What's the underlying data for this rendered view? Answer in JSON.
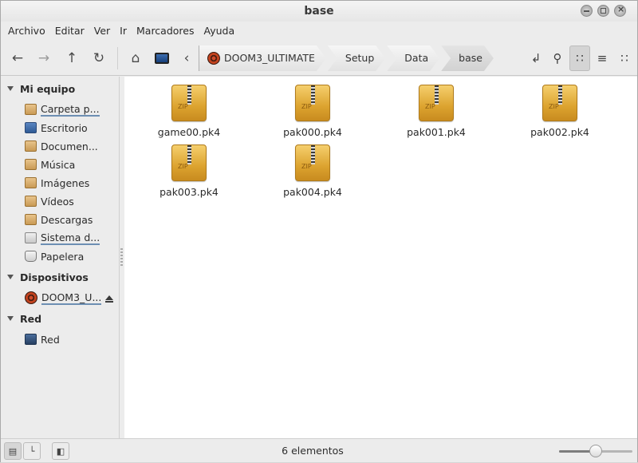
{
  "window": {
    "title": "base"
  },
  "menu": [
    "Archivo",
    "Editar",
    "Ver",
    "Ir",
    "Marcadores",
    "Ayuda"
  ],
  "toolbar": {
    "back_icon": "arrow-left-icon",
    "forward_icon": "arrow-right-icon",
    "up_icon": "arrow-up-icon",
    "reload_icon": "reload-icon",
    "home_icon": "home-icon",
    "computer_icon": "computer-icon",
    "breadcrumbs": [
      "DOOM3_ULTIMATE",
      "Setup",
      "Data",
      "base"
    ]
  },
  "view_modes": {
    "active": "icons"
  },
  "sidebar": {
    "sections": [
      {
        "title": "Mi equipo",
        "items": [
          {
            "label": "Carpeta p...",
            "icon": "home-folder-icon"
          },
          {
            "label": "Escritorio",
            "icon": "desktop-icon"
          },
          {
            "label": "Documen...",
            "icon": "documents-folder-icon"
          },
          {
            "label": "Música",
            "icon": "music-folder-icon"
          },
          {
            "label": "Imágenes",
            "icon": "pictures-folder-icon"
          },
          {
            "label": "Vídeos",
            "icon": "videos-folder-icon"
          },
          {
            "label": "Descargas",
            "icon": "downloads-folder-icon"
          },
          {
            "label": "Sistema d...",
            "icon": "filesystem-icon"
          },
          {
            "label": "Papelera",
            "icon": "trash-icon"
          }
        ]
      },
      {
        "title": "Dispositivos",
        "items": [
          {
            "label": "DOOM3_U...",
            "icon": "optical-disc-icon"
          }
        ]
      },
      {
        "title": "Red",
        "items": [
          {
            "label": "Red",
            "icon": "network-icon"
          }
        ]
      }
    ]
  },
  "files": [
    {
      "name": "game00.pk4",
      "icon": "zip-archive-icon"
    },
    {
      "name": "pak000.pk4",
      "icon": "zip-archive-icon"
    },
    {
      "name": "pak001.pk4",
      "icon": "zip-archive-icon"
    },
    {
      "name": "pak002.pk4",
      "icon": "zip-archive-icon"
    },
    {
      "name": "pak003.pk4",
      "icon": "zip-archive-icon"
    },
    {
      "name": "pak004.pk4",
      "icon": "zip-archive-icon"
    }
  ],
  "status": {
    "text": "6 elementos",
    "zoom_level": 0.5
  }
}
